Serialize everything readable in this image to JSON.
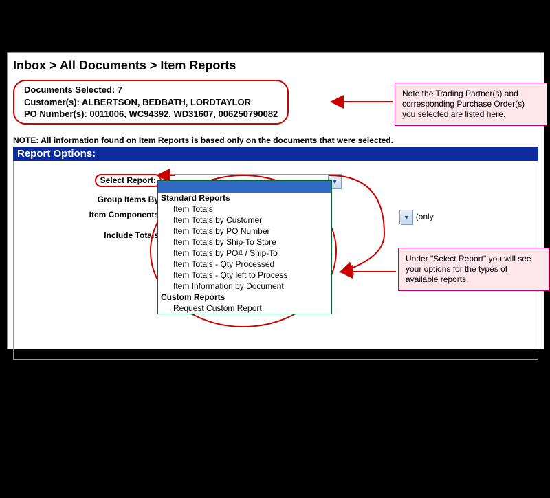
{
  "breadcrumb": {
    "text": "Inbox > All Documents > Item Reports"
  },
  "doc_selected": {
    "line1": "Documents Selected: 7",
    "line2": "Customer(s): ALBERTSON, BEDBATH, LORDTAYLOR",
    "line3": "PO Number(s): 0011006, WC94392, WD31607, 006250790082"
  },
  "note_line": "NOTE: All information found on Item Reports is based only on the documents that were selected.",
  "report_header": "Report Options:",
  "labels": {
    "select_report": "Select Report:",
    "group_items": "Group Items By:",
    "item_components": "Item Components:",
    "include_totals": "Include Totals:"
  },
  "only_hint": "(only",
  "dropdown": {
    "groups": [
      {
        "name": "Standard Reports",
        "items": [
          "Item Totals",
          "Item Totals by Customer",
          "Item Totals by PO Number",
          "Item Totals by Ship-To Store",
          "Item Totals by PO# / Ship-To",
          "Item Totals - Qty Processed",
          "Item Totals - Qty left to Process",
          "Item Information by Document"
        ]
      },
      {
        "name": "Custom Reports",
        "items": [
          "Request Custom Report"
        ]
      }
    ]
  },
  "callouts": {
    "note1": "Note the Trading Partner(s) and corresponding Purchase Order(s) you selected are listed here.",
    "note2": "Under \"Select Report\" you will see your options for the types of available reports."
  }
}
